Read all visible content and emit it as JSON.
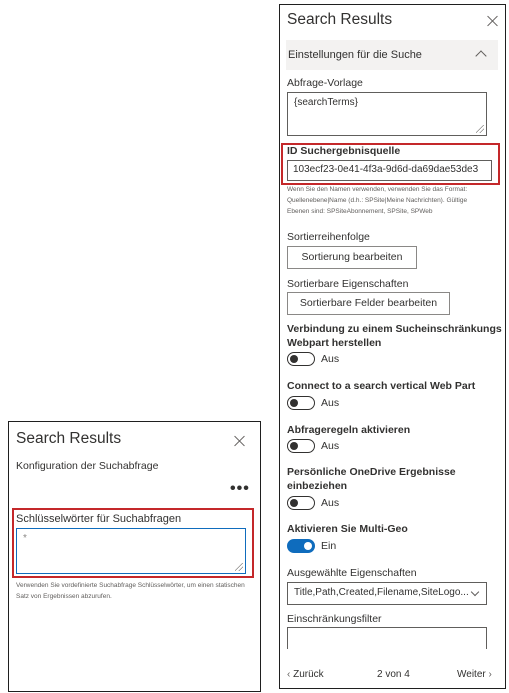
{
  "left_panel": {
    "title": "Search Results",
    "subtitle": "Konfiguration der Suchabfrage",
    "more_label": "•••",
    "keywords_label": "Schlüsselwörter für Suchabfragen",
    "keywords_value": "*",
    "help_text": "Verwenden Sie vordefinierte Suchabfrage Schlüsselwörter, um einen statischen Satz von Ergebnissen abzurufen."
  },
  "right_panel": {
    "title": "Search Results",
    "section_header": "Einstellungen für die Suche",
    "query_template_label": "Abfrage-Vorlage",
    "query_template_value": "{searchTerms}",
    "result_source_label": "ID Suchergebnisquelle",
    "result_source_value": "103ecf23-0e41-4f3a-9d6d-da69dae53de3",
    "help_lines": [
      "Wenn Sie den Namen verwenden, verwenden Sie das Format:",
      "Quellenebene|Name (d.h.: SPSite|Meine Nachrichten). Gültige",
      "Ebenen sind: SPSiteAbonnement, SPSite, SPWeb"
    ],
    "sort_order_label": "Sortierreihenfolge",
    "sort_edit_button": "Sortierung bearbeiten",
    "sortable_props_label": "Sortierbare Eigenschaften",
    "sortable_edit_button": "Sortierbare Felder bearbeiten",
    "refiner_connect_label_1": "Verbindung zu einem Sucheinschränkungs",
    "refiner_connect_label_2": "Webpart herstellen",
    "refiner_connect_state": "Aus",
    "vertical_label": "Connect to a search vertical Web Part",
    "vertical_state": "Aus",
    "query_rules_label": "Abfrageregeln aktivieren",
    "query_rules_state": "Aus",
    "onedrive_label_1": "Persönliche OneDrive Ergebnisse",
    "onedrive_label_2": "einbeziehen",
    "onedrive_state": "Aus",
    "multigeo_label": "Aktivieren Sie Multi-Geo",
    "multigeo_state": "Ein",
    "selected_props_label": "Ausgewählte Eigenschaften",
    "selected_props_value": "Title,Path,Created,Filename,SiteLogo...",
    "refinement_filter_label": "Einschränkungsfilter",
    "nav_prev": "Zurück",
    "nav_page": "2 von 4",
    "nav_next": "Weiter"
  },
  "colors": {
    "highlight": "#c4282a",
    "toggle_on": "#0f6cbd"
  }
}
